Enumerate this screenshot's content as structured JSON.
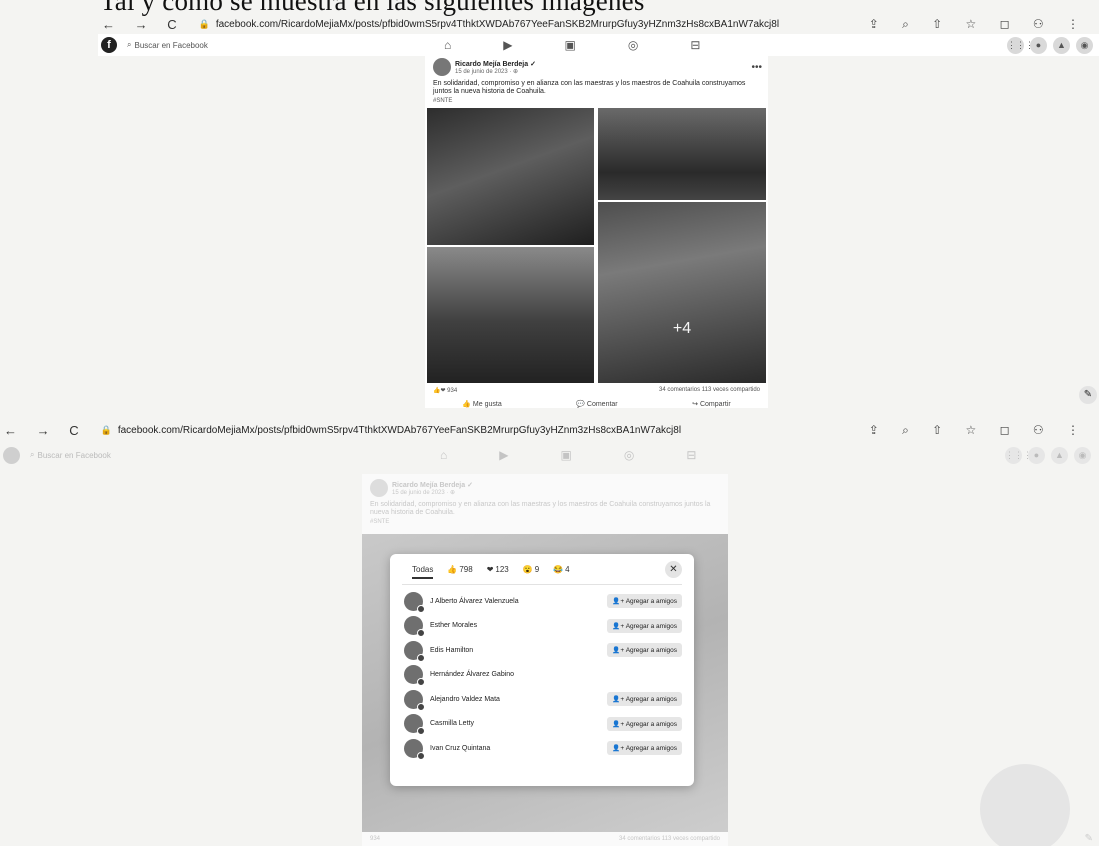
{
  "heading": "Tal y como se muestra en las siguientes imágenes",
  "shot1": {
    "browser": {
      "url": "facebook.com/RicardoMejiaMx/posts/pfbid0wmS5rpv4TthktXWDAb767YeeFanSKB2MrurpGfuy3yHZnm3zHs8cxBA1nW7akcj8l",
      "nav": "← → C",
      "actions": "⇪ ⌕ ⇧ ☆ ◻ ⚇ ⋮"
    },
    "fb": {
      "search_placeholder": "Buscar en Facebook",
      "nav_icons": [
        "⌂",
        "▶",
        "▣",
        "◎",
        "⊟"
      ],
      "right_icons": [
        "⋮⋮⋮",
        "●",
        "▲",
        "◉"
      ]
    },
    "post": {
      "author": "Ricardo Mejía Berdeja ✓",
      "date": "15 de junio de 2023 · ⊕",
      "text": "En solidaridad, compromiso y en alianza con las maestras y los maestros de Coahuila construyamos juntos la nueva historia de Coahuila.",
      "tag": "#SNTE",
      "more_photos": "+4",
      "reactions_count": "934",
      "comments_shares": "34 comentarios   113 veces compartido",
      "actions": [
        "Me gusta",
        "Comentar",
        "Compartir"
      ]
    }
  },
  "shot2": {
    "browser": {
      "url": "facebook.com/RicardoMejiaMx/posts/pfbid0wmS5rpv4TthktXWDAb767YeeFanSKB2MrurpGfuy3yHZnm3zHs8cxBA1nW7akcj8l",
      "nav": "← → C",
      "actions": "⇪ ⌕ ⇧ ☆ ◻ ⚇ ⋮"
    },
    "fb": {
      "search_placeholder": "Buscar en Facebook",
      "nav_icons": [
        "⌂",
        "▶",
        "▣",
        "◎",
        "⊟"
      ],
      "right_icons": [
        "⋮⋮⋮",
        "●",
        "▲",
        "◉"
      ]
    },
    "bg_post": {
      "author": "Ricardo Mejía Berdeja ✓",
      "date": "15 de junio de 2023 · ⊕",
      "text": "En solidaridad, compromiso y en alianza con las maestras y los maestros de Coahuila construyamos juntos la nueva historia de Coahuila.",
      "tag": "#SNTE",
      "stats_left": "934",
      "stats_right": "34 comentarios   113 veces compartido"
    },
    "modal": {
      "tabs": [
        {
          "label": "Todas",
          "icon": "",
          "count": ""
        },
        {
          "label": "",
          "icon": "👍",
          "count": "798"
        },
        {
          "label": "",
          "icon": "❤",
          "count": "123"
        },
        {
          "label": "",
          "icon": "😮",
          "count": "9"
        },
        {
          "label": "",
          "icon": "😂",
          "count": "4"
        }
      ],
      "close": "✕",
      "people": [
        {
          "name": "J Alberto Álvarez Valenzuela",
          "button": "Agregar a amigos"
        },
        {
          "name": "Esther Morales",
          "button": "Agregar a amigos"
        },
        {
          "name": "Edis Hamilton",
          "button": "Agregar a amigos"
        },
        {
          "name": "Hernández Álvarez Gabino",
          "button": ""
        },
        {
          "name": "Alejandro Valdez Mata",
          "button": "Agregar a amigos"
        },
        {
          "name": "Casmilla Letty",
          "button": "Agregar a amigos"
        },
        {
          "name": "Ivan Cruz Quintana",
          "button": "Agregar a amigos"
        }
      ]
    }
  }
}
